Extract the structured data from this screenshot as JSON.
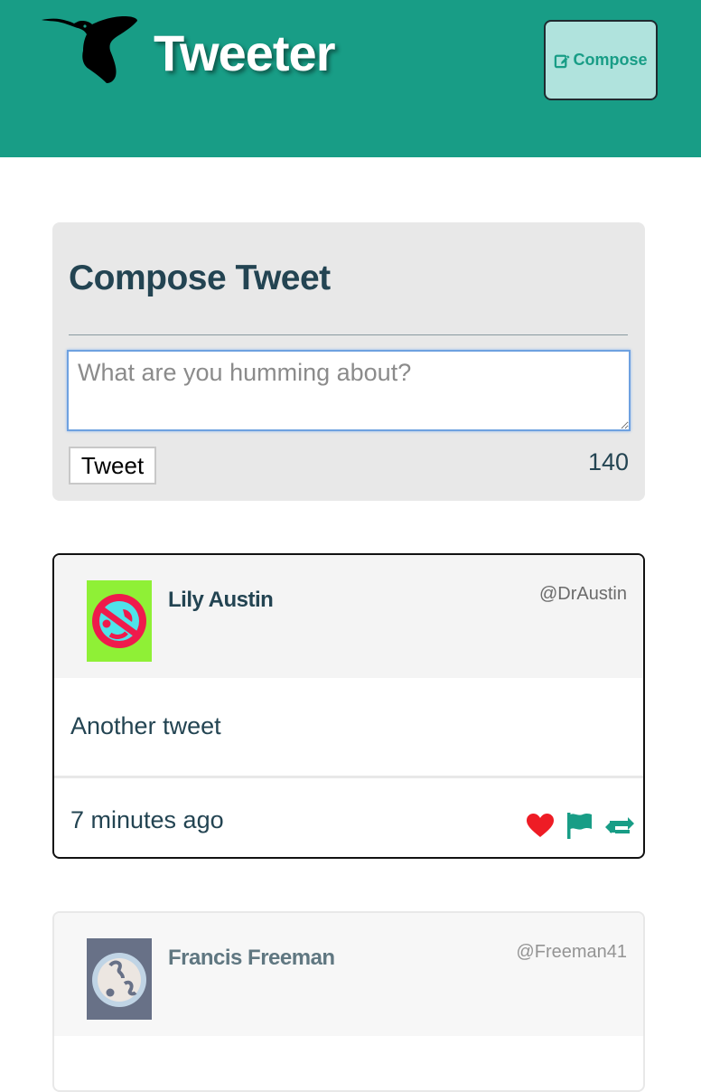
{
  "header": {
    "title": "Tweeter",
    "compose_label": "Compose",
    "logo_icon": "hummingbird-logo-icon",
    "compose_icon": "pencil-square-icon",
    "brand_color": "#189d86"
  },
  "compose": {
    "heading": "Compose Tweet",
    "placeholder": "What are you humming about?",
    "value": "",
    "submit_label": "Tweet",
    "char_counter": "140"
  },
  "tweets": [
    {
      "name": "Lily Austin",
      "handle": "@DrAustin",
      "content": "Another tweet",
      "time": "7 minutes ago",
      "avatar_icon": "avatar-icon",
      "actions": [
        "heart-icon",
        "flag-icon",
        "retweet-icon"
      ],
      "action_colors": {
        "heart": "#ee1c25",
        "flag": "#189d86",
        "retweet": "#189d86"
      }
    },
    {
      "name": "Francis Freeman",
      "handle": "@Freeman41",
      "avatar_icon": "avatar-icon"
    }
  ]
}
